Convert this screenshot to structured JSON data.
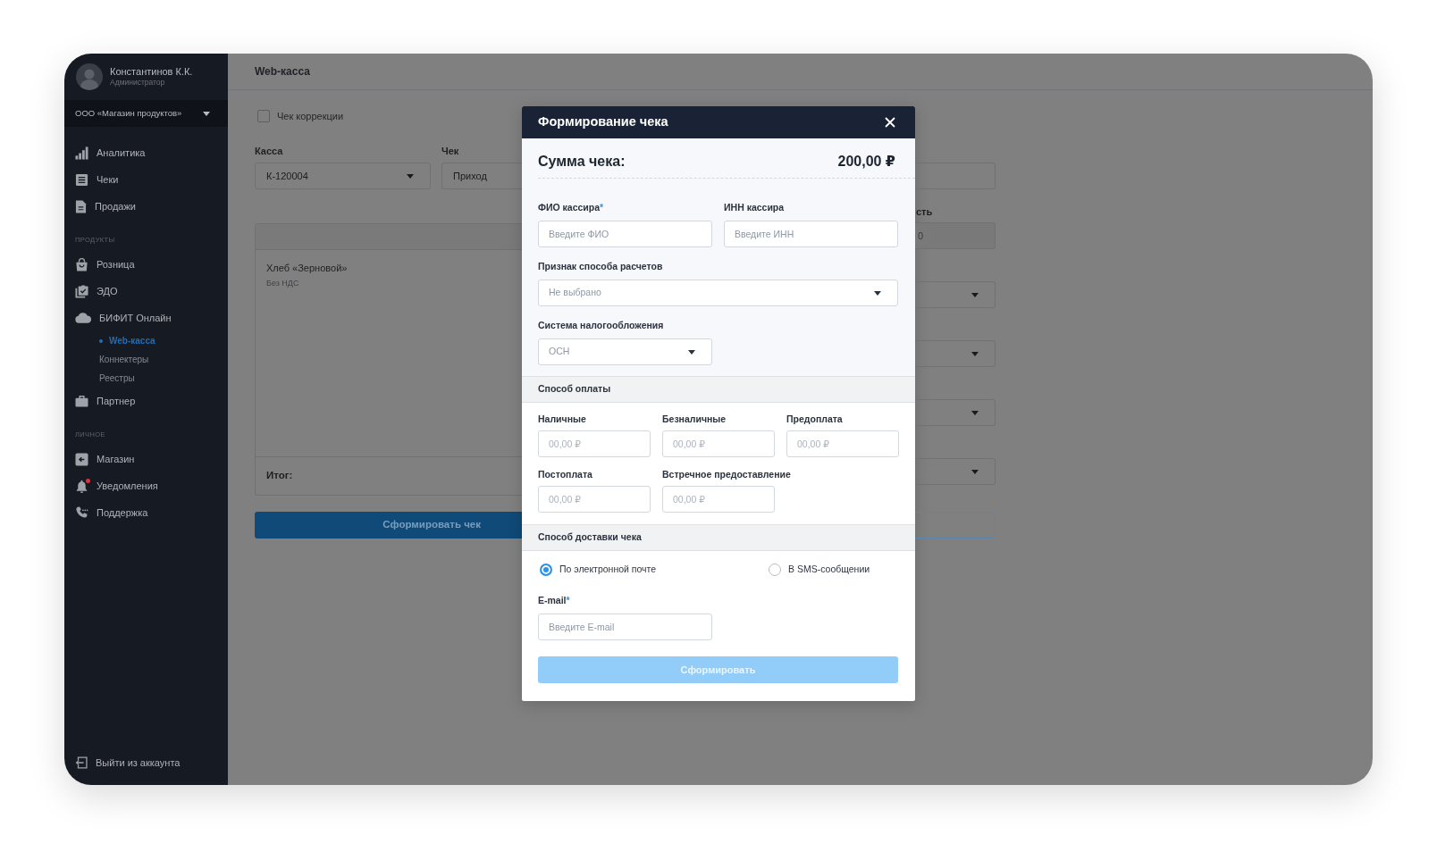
{
  "sidebar": {
    "user": {
      "name": "Константинов К.К.",
      "role": "Администратор"
    },
    "organization": "ООО «Магазин продуктов»",
    "sections": [
      {
        "items": [
          {
            "label": "Аналитика",
            "selected": false,
            "unread": false
          },
          {
            "label": "Чеки",
            "selected": false,
            "unread": false
          },
          {
            "label": "Продажи",
            "selected": false,
            "unread": false
          }
        ]
      },
      {
        "title": "ПРОДУКТЫ",
        "items": [
          {
            "label": "Розница",
            "selected": false,
            "unread": false
          },
          {
            "label": "ЭДО",
            "selected": false,
            "unread": false
          },
          {
            "label": "БИФИТ Онлайн",
            "selected": false,
            "unread": false,
            "children": [
              {
                "label": "Web-касса",
                "selected": true
              },
              {
                "label": "Коннектеры",
                "selected": false
              },
              {
                "label": "Реестры",
                "selected": false
              }
            ]
          },
          {
            "label": "Партнер",
            "selected": false,
            "unread": false
          }
        ]
      },
      {
        "title": "ЛИЧНОЕ",
        "items": [
          {
            "label": "Магазин",
            "selected": false,
            "unread": false
          },
          {
            "label": "Уведомления",
            "selected": false,
            "unread": true
          },
          {
            "label": "Поддержка",
            "selected": false,
            "unread": false
          }
        ]
      }
    ],
    "logout": "Выйти из аккаунта"
  },
  "page": {
    "title": "Web-касса",
    "correction": {
      "label": "Чек коррекции",
      "checked": false
    },
    "fields": [
      {
        "kind": "select",
        "label": "Касса",
        "value": "К-120004"
      },
      {
        "kind": "input",
        "label": "Чек",
        "value": "Приход"
      }
    ],
    "items_table": {
      "rows": [
        {
          "name": "Хлеб «Зерновой»",
          "tax": "Без НДС"
        }
      ],
      "total_label": "Итог:"
    },
    "submit": "Сформировать чек",
    "side_fields": [
      {
        "kind": "input"
      },
      {
        "kind": "readonly",
        "label": "сть",
        "value": "0"
      },
      {
        "kind": "select"
      },
      {
        "kind": "select"
      },
      {
        "kind": "select"
      },
      {
        "kind": "select"
      }
    ],
    "side_button": {
      "kind": "outline"
    }
  },
  "modal": {
    "title": "Формирование чека",
    "sum": {
      "label": "Сумма чека:",
      "value": "200,00 ₽"
    },
    "cashier_fields": [
      {
        "label": "ФИО кассира",
        "required_mark": "*",
        "placeholder": "Введите ФИО"
      },
      {
        "label": "ИНН кассира",
        "placeholder": "Введите ИНН"
      }
    ],
    "payment_sign": {
      "label": "Признак способа расчетов",
      "value": "Не выбрано"
    },
    "tax_system": {
      "label": "Система налогообложения",
      "value": "ОСН"
    },
    "payment": {
      "title": "Способ оплаты",
      "fields": [
        {
          "label": "Наличные",
          "placeholder": "00,00 ₽"
        },
        {
          "label": "Безналичные",
          "placeholder": "00,00 ₽"
        },
        {
          "label": "Предоплата",
          "placeholder": "00,00 ₽"
        },
        {
          "label": "Постоплата",
          "placeholder": "00,00 ₽"
        },
        {
          "label": "Встречное предоставление",
          "placeholder": "00,00 ₽"
        }
      ]
    },
    "delivery": {
      "title": "Способ доставки чека",
      "options": [
        {
          "label": "По электронной почте",
          "selected": true
        },
        {
          "label": "В SMS-сообщении",
          "selected": false
        }
      ],
      "email": {
        "label": "E-mail",
        "required_mark": "*",
        "placeholder": "Введите E-mail"
      }
    },
    "submit": {
      "label": "Сформировать",
      "disabled": true
    }
  }
}
